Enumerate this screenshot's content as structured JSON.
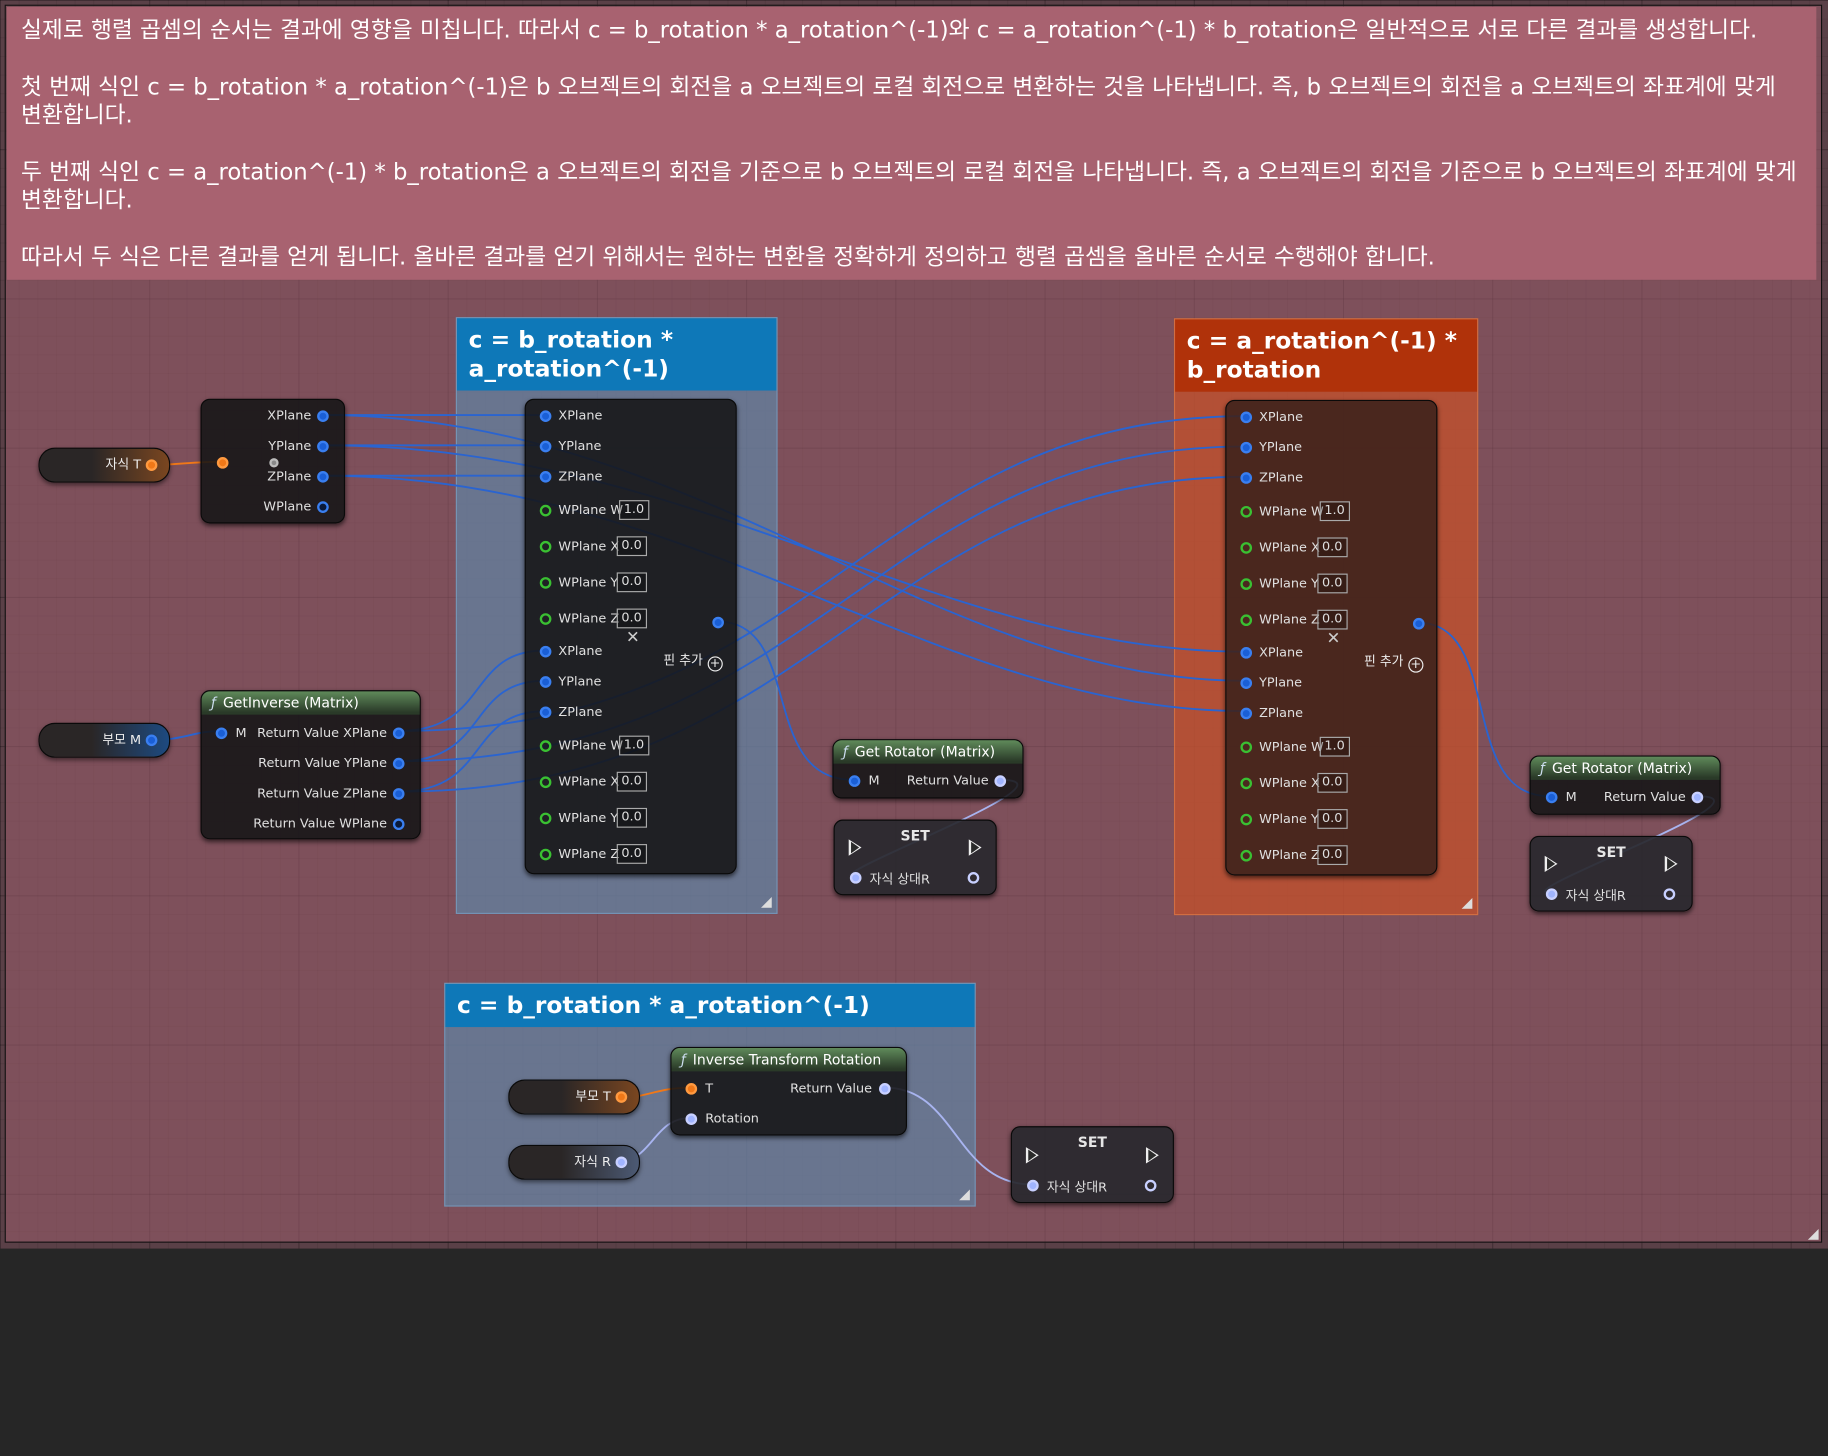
{
  "comment_text": [
    "실제로 행렬 곱셈의 순서는 결과에 영향을 미칩니다. 따라서 c = b_rotation * a_rotation^(-1)와 c = a_rotation^(-1) * b_rotation은 일반적으로 서로 다른 결과를 생성합니다.",
    "첫 번째 식인 c = b_rotation * a_rotation^(-1)은 b 오브젝트의 회전을 a 오브젝트의 로컬 회전으로 변환하는 것을 나타냅니다. 즉, b 오브젝트의 회전을 a 오브젝트의 좌표계에 맞게 변환합니다.",
    "두 번째 식인 c = a_rotation^(-1) * b_rotation은 a 오브젝트의 회전을 기준으로 b 오브젝트의 로컬 회전을 나타냅니다. 즉, a 오브젝트의 회전을 기준으로 b 오브젝트의 좌표계에 맞게 변환합니다.",
    "따라서 두 식은 다른 결과를 얻게 됩니다. 올바른 결과를 얻기 위해서는 원하는 변환을 정확하게 정의하고 행렬 곱셈을 올바른 순서로 수행해야 합니다."
  ],
  "comments": {
    "left": "c = b_rotation * a_rotation^(-1)",
    "right": "c = a_rotation^(-1) * b_rotation",
    "bottom": "c = b_rotation * a_rotation^(-1)"
  },
  "vars": {
    "child_t": "자식 T",
    "parent_m": "부모 M",
    "parent_t": "부모 T",
    "child_r": "자식 R",
    "child_rel_r": "자식 상대R"
  },
  "break_node": {
    "pins": [
      "XPlane",
      "YPlane",
      "ZPlane",
      "WPlane"
    ]
  },
  "get_inverse": {
    "title": "GetInverse (Matrix)",
    "input": "M",
    "outputs": [
      "Return Value XPlane",
      "Return Value YPlane",
      "Return Value ZPlane",
      "Return Value WPlane"
    ]
  },
  "make_node": {
    "pins": [
      "XPlane",
      "YPlane",
      "ZPlane",
      "WPlane W",
      "WPlane X",
      "WPlane Y",
      "WPlane Z",
      "XPlane",
      "YPlane",
      "ZPlane",
      "WPlane W",
      "WPlane X",
      "WPlane Y",
      "WPlane Z"
    ],
    "values": [
      "",
      "",
      "",
      "1.0",
      "0.0",
      "0.0",
      "0.0",
      "",
      "",
      "",
      "1.0",
      "0.0",
      "0.0",
      "0.0"
    ],
    "add_pin": "핀 추가"
  },
  "get_rotator": {
    "title": "Get Rotator (Matrix)",
    "input": "M",
    "output": "Return Value"
  },
  "set_node": {
    "title": "SET"
  },
  "inverse_transform": {
    "title": "Inverse Transform Rotation",
    "inputs": [
      "T",
      "Rotation"
    ],
    "output": "Return Value"
  },
  "colors": {
    "comment_header": "#a86270",
    "blue_title": "#0e78b8",
    "red_title": "#b0320a",
    "wire_blue": "#2a64d0",
    "wire_orange": "#f07818",
    "wire_lavender": "#a8b4f0"
  },
  "icons": [
    "function-icon",
    "exec-pin-icon",
    "remove-pin-icon",
    "add-pin-icon",
    "resize-icon"
  ]
}
